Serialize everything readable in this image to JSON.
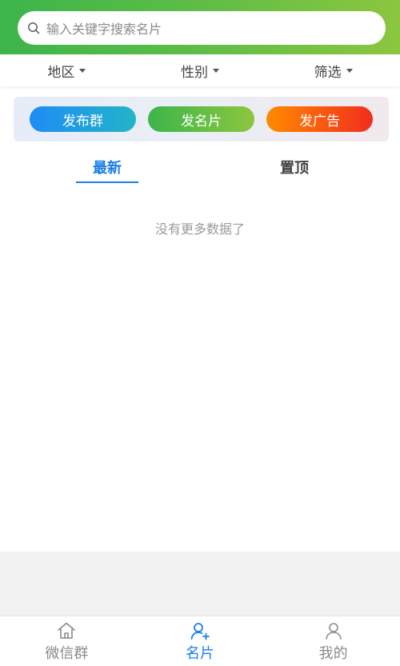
{
  "search": {
    "placeholder": "输入关键字搜索名片"
  },
  "filters": [
    {
      "label": "地区"
    },
    {
      "label": "性别"
    },
    {
      "label": "筛选"
    }
  ],
  "actions": [
    {
      "label": "发布群"
    },
    {
      "label": "发名片"
    },
    {
      "label": "发广告"
    }
  ],
  "tabs": [
    {
      "label": "最新",
      "active": true
    },
    {
      "label": "置顶",
      "active": false
    }
  ],
  "empty_message": "没有更多数据了",
  "tabbar": [
    {
      "label": "微信群",
      "icon": "home-icon",
      "active": false
    },
    {
      "label": "名片",
      "icon": "add-user-icon",
      "active": true
    },
    {
      "label": "我的",
      "icon": "user-icon",
      "active": false
    }
  ],
  "colors": {
    "brand_green": "#3cb54a",
    "accent_blue": "#1a7fe6",
    "ad_orange": "#ff8a00",
    "ad_red": "#f22d1e"
  }
}
